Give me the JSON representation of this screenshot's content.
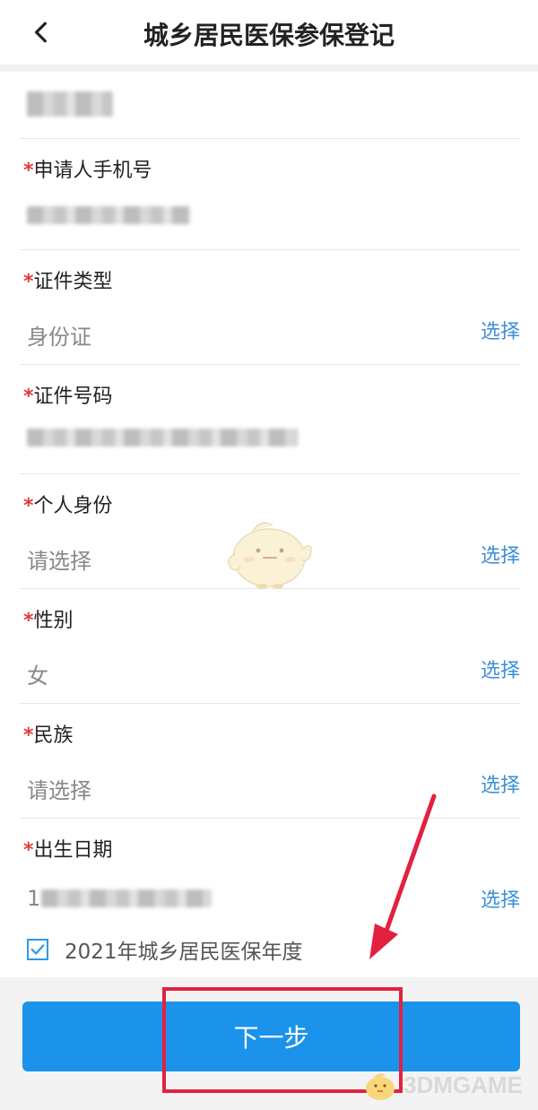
{
  "header": {
    "title": "城乡居民医保参保登记",
    "back_icon": "chevron-left-icon"
  },
  "form": {
    "fields": [
      {
        "label": "",
        "value": "",
        "blurred": true
      },
      {
        "required": "*",
        "label": "申请人手机号",
        "value": "",
        "blurred": true
      },
      {
        "required": "*",
        "label": "证件类型",
        "value": "身份证",
        "action": "选择"
      },
      {
        "required": "*",
        "label": "证件号码",
        "value": "",
        "blurred": true
      },
      {
        "required": "*",
        "label": "个人身份",
        "value": "请选择",
        "action": "选择"
      },
      {
        "required": "*",
        "label": "性别",
        "value": "女",
        "action": "选择"
      },
      {
        "required": "*",
        "label": "民族",
        "value": "请选择",
        "action": "选择"
      },
      {
        "required": "*",
        "label": "出生日期",
        "value": "1",
        "blurred": true,
        "action": "选择"
      }
    ]
  },
  "year_checkbox": {
    "checked": true,
    "label": "2021年城乡居民医保年度"
  },
  "next_button": {
    "label": "下一步"
  },
  "watermark": {
    "text": "3DMGAME"
  },
  "colors": {
    "accent": "#1b93ea",
    "link": "#3d8fd6",
    "required": "#e23b3b",
    "annotation": "#e2213f"
  }
}
